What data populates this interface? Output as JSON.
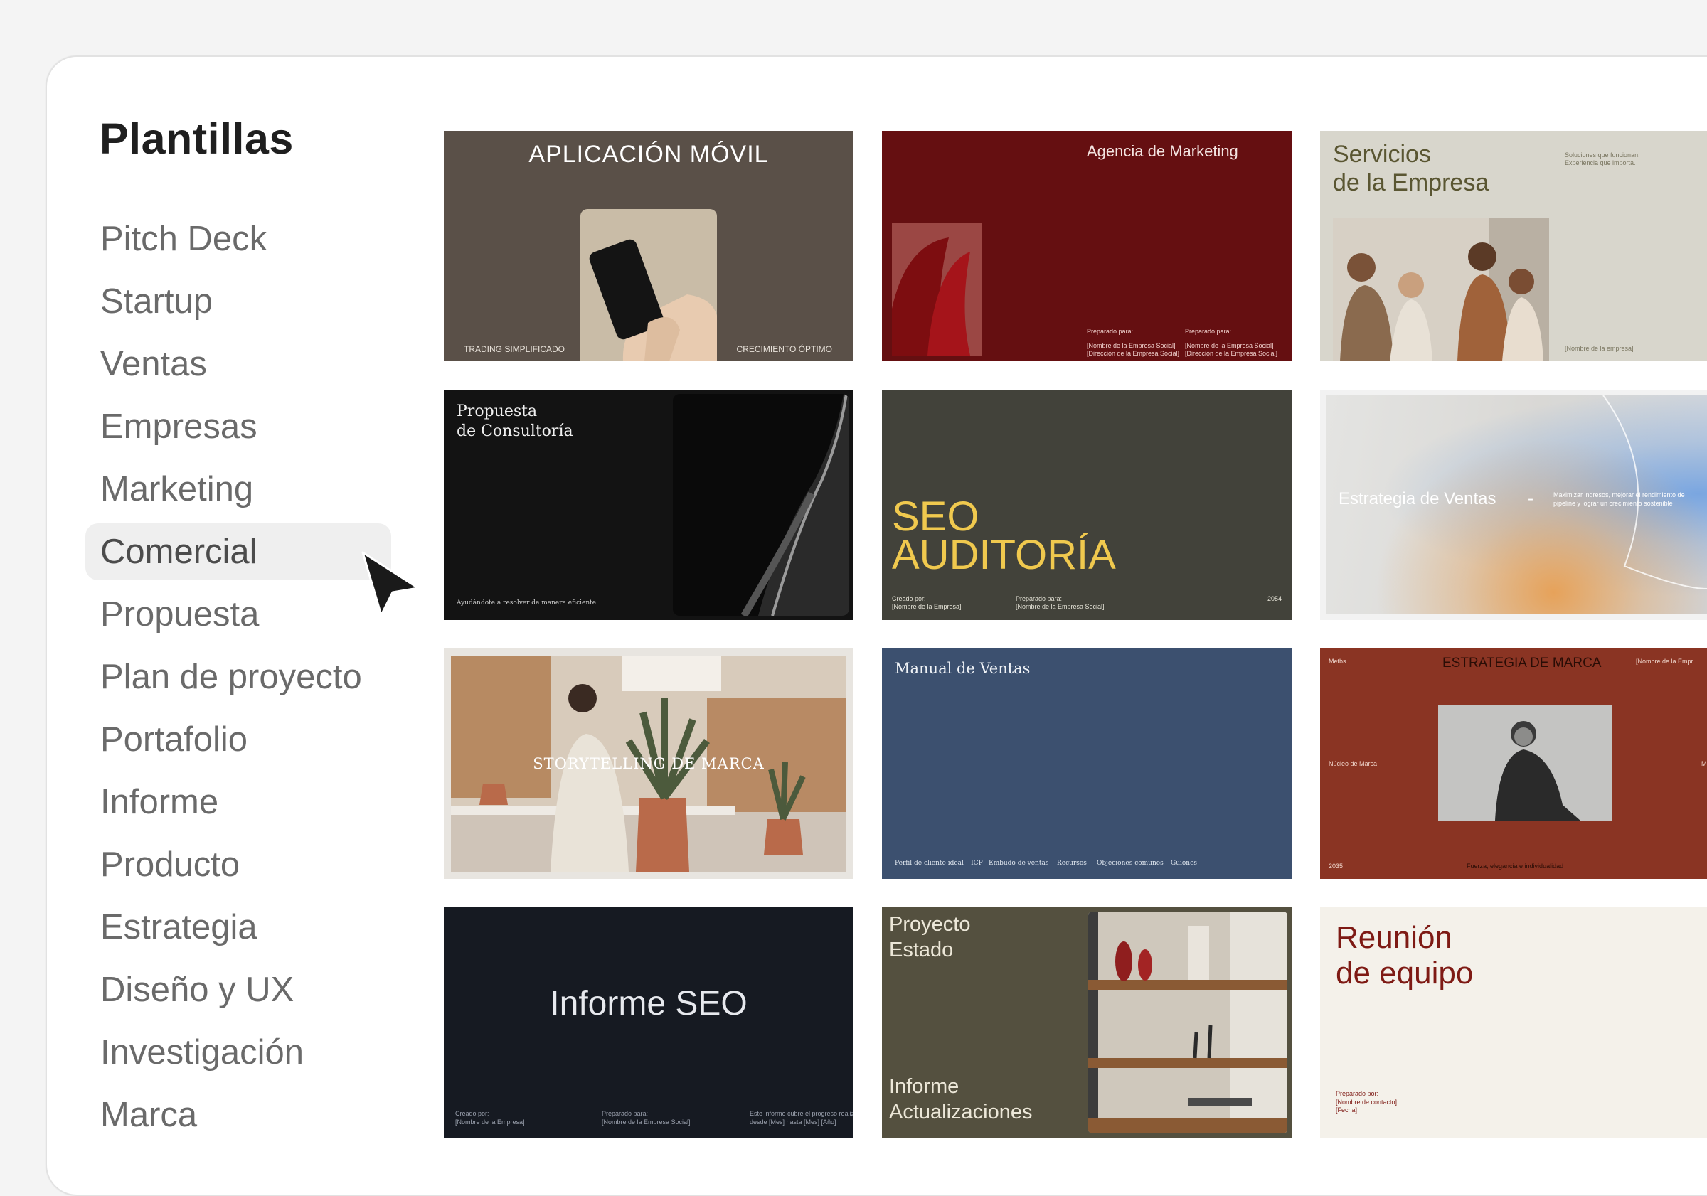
{
  "page_title": "Plantillas",
  "sidebar": {
    "items": [
      {
        "label": "Pitch Deck"
      },
      {
        "label": "Startup"
      },
      {
        "label": "Ventas"
      },
      {
        "label": "Empresas"
      },
      {
        "label": "Marketing"
      },
      {
        "label": "Comercial",
        "selected": true
      },
      {
        "label": "Propuesta"
      },
      {
        "label": "Plan de proyecto"
      },
      {
        "label": "Portafolio"
      },
      {
        "label": "Informe"
      },
      {
        "label": "Producto"
      },
      {
        "label": "Estrategia"
      },
      {
        "label": "Diseño y UX"
      },
      {
        "label": "Investigación"
      },
      {
        "label": "Marca"
      }
    ]
  },
  "templates": {
    "app_movil": {
      "title": "APLICACIÓN MÓVIL",
      "left_caption": "TRADING SIMPLIFICADO",
      "right_caption": "CRECIMIENTO ÓPTIMO",
      "bg": "#5a5048"
    },
    "agencia_marketing": {
      "title": "Agencia de Marketing",
      "prep_label_1": "Preparado para:",
      "prep_value_1a": "[Nombre de la Empresa Social]",
      "prep_value_1b": "[Dirección de la Empresa Social]",
      "prep_label_2": "Preparado para:",
      "prep_value_2a": "[Nombre de la Empresa Social]",
      "prep_value_2b": "[Dirección de la Empresa Social]",
      "bg": "#650f11"
    },
    "servicios_empresa": {
      "title_line1": "Servicios",
      "title_line2": "de la Empresa",
      "tagline_1": "Soluciones que funcionan.",
      "tagline_2": "Experiencia que importa.",
      "company": "[Nombre de la empresa]",
      "bg": "#d8d6cc"
    },
    "propuesta_consultoria": {
      "title_line1": "Propuesta",
      "title_line2": "de Consultoría",
      "subtitle": "Ayudándote a resolver de manera eficiente.",
      "bg": "#131313"
    },
    "seo_auditoria": {
      "title_line1": "SEO",
      "title_line2": "AUDITORÍA",
      "created_label": "Creado por:",
      "created_value": "[Nombre de la Empresa]",
      "prepared_label": "Preparado para:",
      "prepared_value": "[Nombre de la Empresa Social]",
      "year": "2054",
      "bg": "#42423a",
      "accent": "#f0c94e"
    },
    "estrategia_ventas": {
      "title": "Estrategia de Ventas",
      "dash": "-",
      "description_1": "Maximizar ingresos, mejorar el rendimiento de",
      "description_2": "pipeline y lograr un crecimiento sostenible"
    },
    "storytelling": {
      "title": "STORYTELLING DE MARCA"
    },
    "manual_ventas": {
      "title": "Manual de Ventas",
      "links": [
        "Perfil de cliente ideal – ICP",
        "Embudo de ventas",
        "Recursos",
        "Objeciones comunes",
        "Guiones"
      ],
      "bg": "#3c506f"
    },
    "estrategia_marca": {
      "title": "ESTRATEGIA DE MARCA",
      "top_left": "Metbs",
      "top_right": "[Nombre de la Empr",
      "mid_left": "Núcleo de Marca",
      "mid_right": "Mensa",
      "bottom_left": "2035",
      "bottom_tagline": "Fuerza, elegancia e individualidad",
      "bg": "#8a3423"
    },
    "informe_seo": {
      "title": "Informe SEO",
      "created_label": "Creado por:",
      "created_value": "[Nombre de la Empresa]",
      "prepared_label": "Preparado para:",
      "prepared_value": "[Nombre de la Empresa Social]",
      "note_1": "Este informe cubre el progreso realizado",
      "note_2": "desde [Mes] hasta [Mes] [Año]",
      "bg": "#161a22"
    },
    "proyecto_estado": {
      "title_line1": "Proyecto",
      "title_line2": "Estado",
      "bottom_line1": "Informe",
      "bottom_line2": "Actualizaciones",
      "bg": "#54503f"
    },
    "reunion_equipo": {
      "title_line1": "Reunión",
      "title_line2": "de equipo",
      "prep_label": "Preparado por:",
      "prep_value": "[Nombre de contacto]",
      "date": "[Fecha]",
      "bg": "#f4f1ea",
      "accent": "#7e1a14"
    }
  }
}
